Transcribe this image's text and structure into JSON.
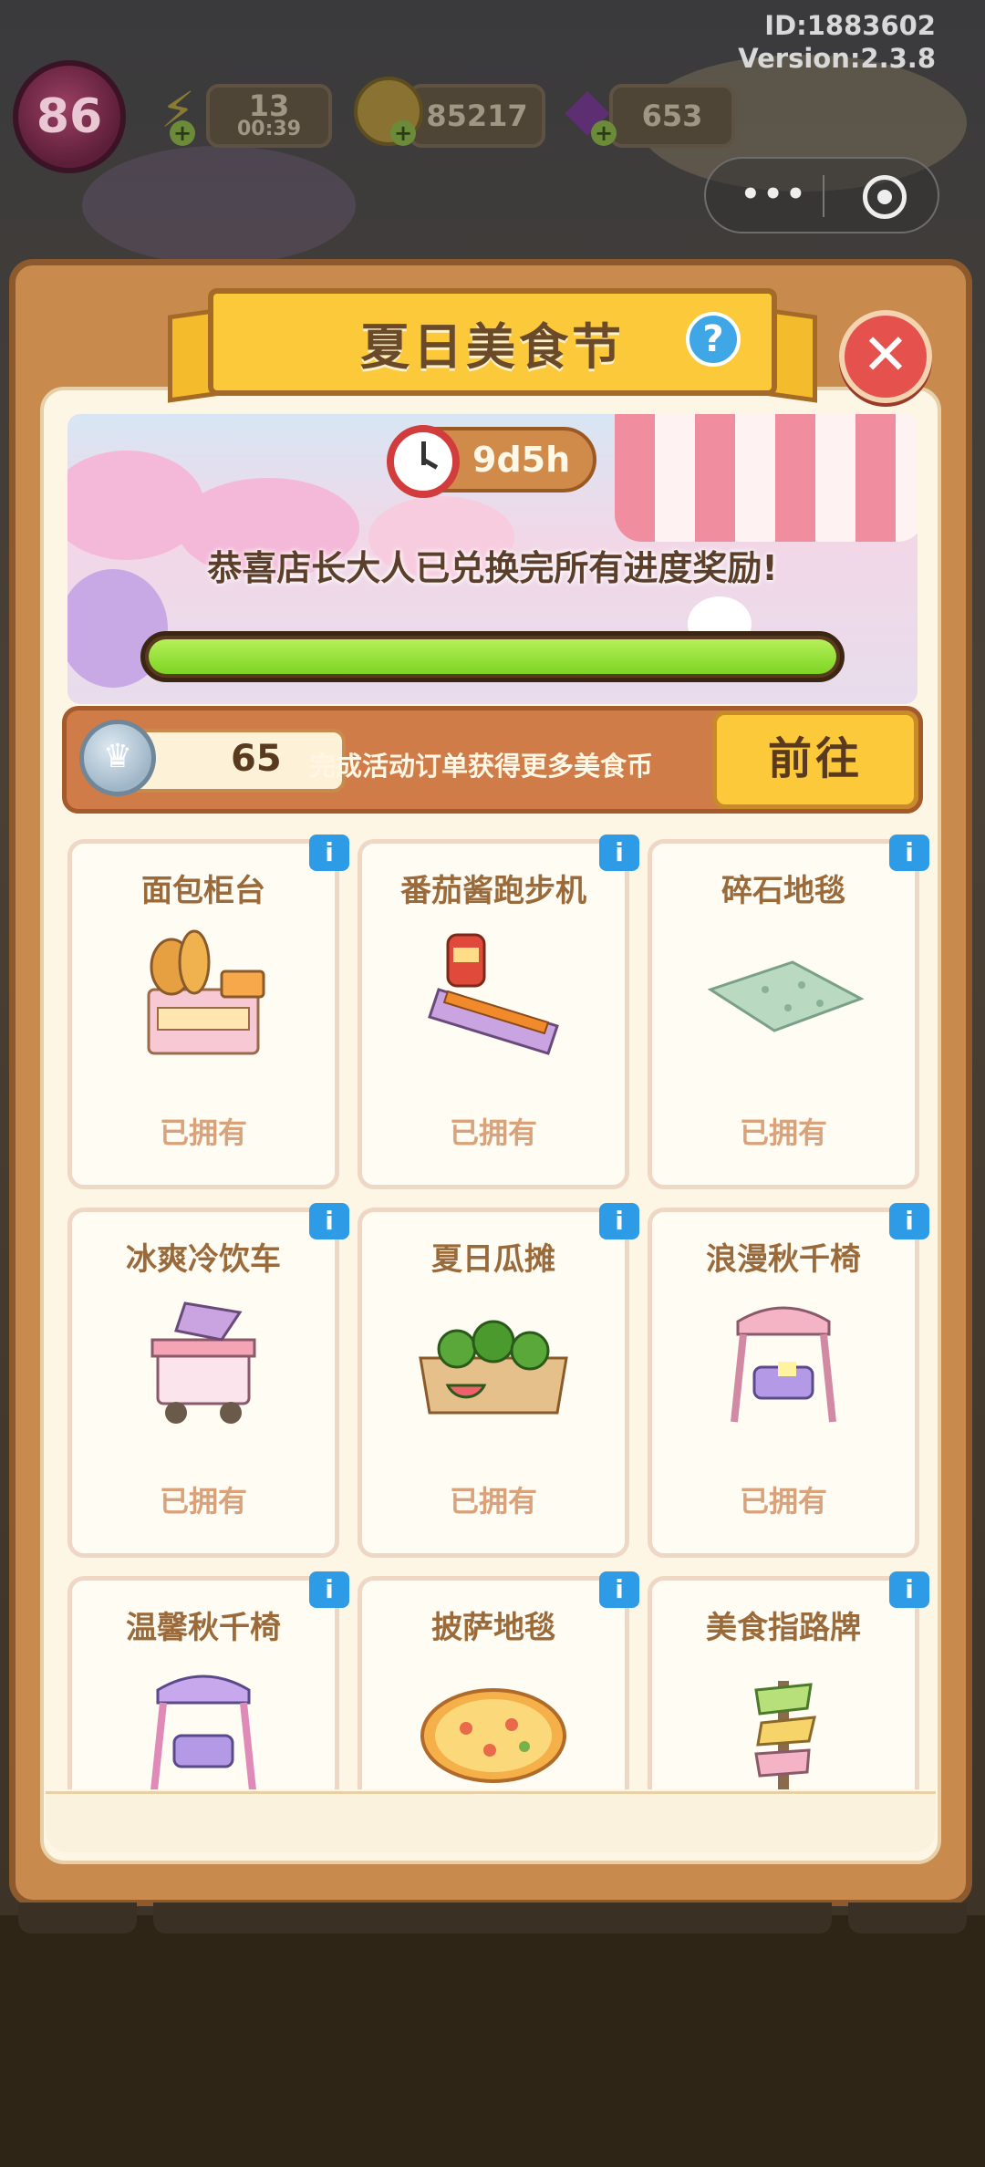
{
  "hud": {
    "id_text": "ID:1883602",
    "version_text": "Version:2.3.8",
    "level": "86",
    "energy": "13",
    "energy_timer": "00:39",
    "coins": "85217",
    "gems": "653"
  },
  "panel": {
    "title": "夏日美食节",
    "help_label": "?",
    "close_label": "✕"
  },
  "hero": {
    "timer": "9d5h",
    "message": "恭喜店长大人已兑换完所有进度奖励!",
    "progress": 1.0
  },
  "coin_bar": {
    "coin_count": "65",
    "description": "完成活动订单获得更多美食币",
    "go_label": "前往"
  },
  "items": [
    {
      "name": "面包柜台",
      "status": "已拥有",
      "icon": "bread-counter-icon"
    },
    {
      "name": "番茄酱跑步机",
      "status": "已拥有",
      "icon": "ketchup-treadmill-icon"
    },
    {
      "name": "碎石地毯",
      "status": "已拥有",
      "icon": "gravel-rug-icon"
    },
    {
      "name": "冰爽冷饮车",
      "status": "已拥有",
      "icon": "cold-drink-cart-icon"
    },
    {
      "name": "夏日瓜摊",
      "status": "已拥有",
      "icon": "watermelon-stall-icon"
    },
    {
      "name": "浪漫秋千椅",
      "status": "已拥有",
      "icon": "romantic-swing-chair-icon"
    },
    {
      "name": "温馨秋千椅",
      "status": "",
      "icon": "cozy-swing-chair-icon"
    },
    {
      "name": "披萨地毯",
      "status": "",
      "icon": "pizza-rug-icon"
    },
    {
      "name": "美食指路牌",
      "status": "",
      "icon": "food-signpost-icon"
    }
  ],
  "colors": {
    "accent_yellow": "#fbc93a",
    "panel_brown": "#c98a4e",
    "progress_green": "#7dd423",
    "info_blue": "#2d9be6",
    "close_red": "#e5524e"
  }
}
